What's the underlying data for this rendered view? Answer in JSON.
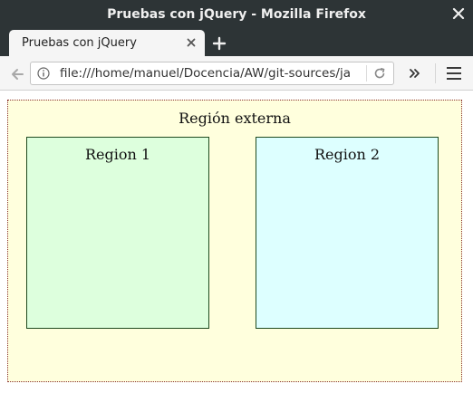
{
  "window": {
    "title": "Pruebas con jQuery - Mozilla Firefox"
  },
  "tabs": [
    {
      "label": "Pruebas con jQuery",
      "active": true
    }
  ],
  "navbar": {
    "url": "file:///home/manuel/Docencia/AW/git-sources/ja"
  },
  "page": {
    "outer_region": {
      "title": "Región externa",
      "background": "#ffffdd",
      "border_color": "#8a3030"
    },
    "regions": [
      {
        "title": "Region 1",
        "background": "#ddffdd"
      },
      {
        "title": "Region 2",
        "background": "#ddffff"
      }
    ]
  },
  "icons": {
    "window_close": "close-icon",
    "tab_close": "close-icon",
    "new_tab": "plus-icon",
    "back": "arrow-left-icon",
    "site_info": "info-icon",
    "reload": "reload-icon",
    "overflow": "double-chevron-right-icon",
    "menu": "hamburger-icon"
  }
}
